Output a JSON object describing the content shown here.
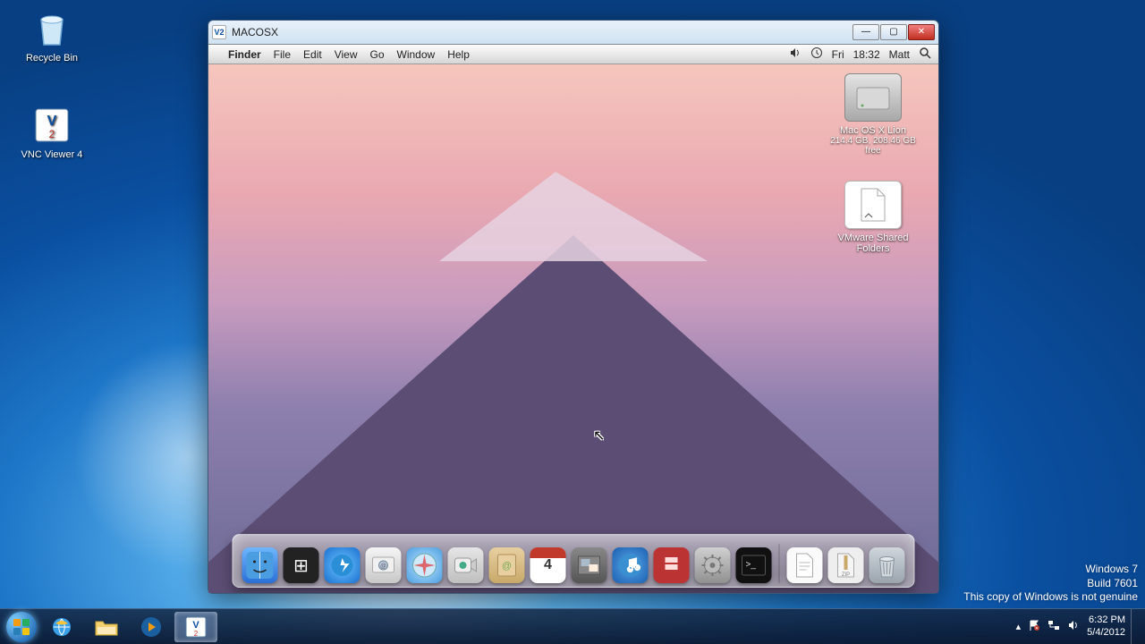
{
  "windows_desktop": {
    "icons": {
      "recycle_bin": "Recycle Bin",
      "vnc_viewer": "VNC Viewer 4"
    },
    "watermark": {
      "line1": "Windows 7",
      "line2": "Build 7601",
      "line3": "This copy of Windows is not genuine"
    }
  },
  "vnc_window": {
    "title": "MACOSX",
    "icon_label": "V2"
  },
  "mac_menubar": {
    "app": "Finder",
    "items": [
      "File",
      "Edit",
      "View",
      "Go",
      "Window",
      "Help"
    ],
    "clock_day": "Fri",
    "clock_time": "18:32",
    "user": "Matt"
  },
  "mac_desktop_items": {
    "hd_name": "Mac OS X Lion",
    "hd_sub": "214.4 GB, 208.46 GB free",
    "shared_name": "VMware Shared Folders"
  },
  "dock": {
    "ical_day": "4"
  },
  "taskbar": {
    "clock_time": "6:32 PM",
    "clock_date": "5/4/2012"
  }
}
